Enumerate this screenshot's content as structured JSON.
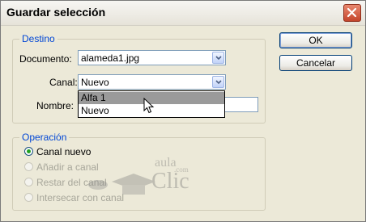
{
  "window": {
    "title": "Guardar selección"
  },
  "buttons": {
    "ok": "OK",
    "cancel": "Cancelar"
  },
  "destino": {
    "legend": "Destino",
    "documento_label": "Documento:",
    "documento_value": "alameda1.jpg",
    "canal_label": "Canal:",
    "canal_value": "Nuevo",
    "nombre_label": "Nombre:",
    "nombre_value": "",
    "canal_options": [
      "Alfa 1",
      "Nuevo"
    ]
  },
  "operacion": {
    "legend": "Operación",
    "options": [
      {
        "label": "Canal nuevo",
        "enabled": true,
        "selected": true
      },
      {
        "label": "Añadir a canal",
        "enabled": false,
        "selected": false
      },
      {
        "label": "Restar del canal",
        "enabled": false,
        "selected": false
      },
      {
        "label": "Intersecar con canal",
        "enabled": false,
        "selected": false
      }
    ]
  },
  "watermark": {
    "line1": "aula",
    "line2": "Clic",
    "line3": ".com"
  },
  "icons": {
    "close": "close-icon",
    "dropdown": "chevron-down-icon",
    "cursor": "mouse-pointer-icon"
  },
  "colors": {
    "accent_legend": "#0046d5",
    "close_button": "#c4452c",
    "radio_selected": "#21a121",
    "dropdown_highlight": "#9a9a9a"
  }
}
